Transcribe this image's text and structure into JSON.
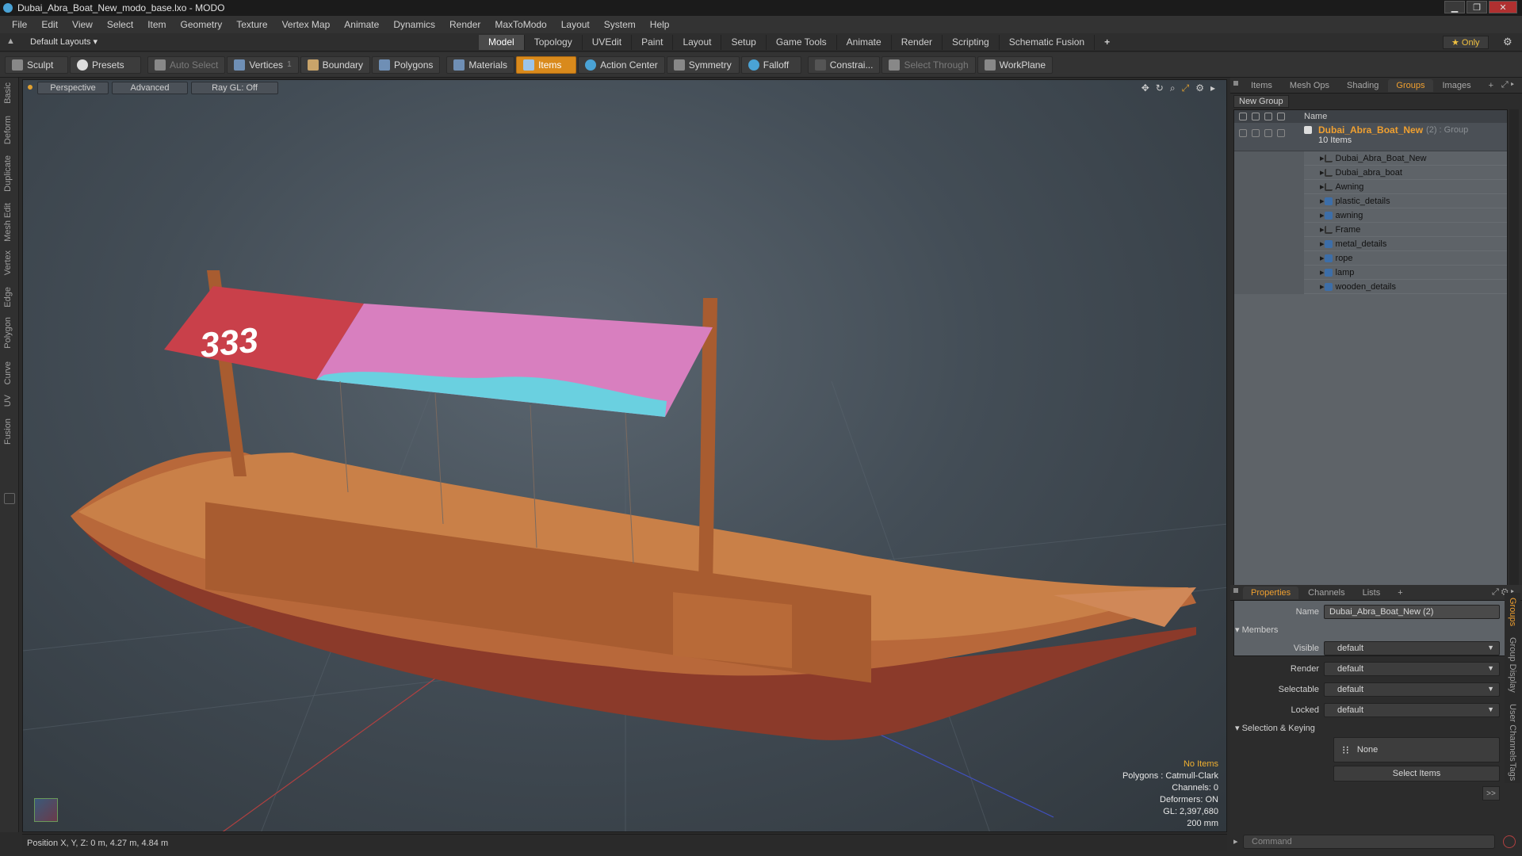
{
  "window": {
    "title": "Dubai_Abra_Boat_New_modo_base.lxo - MODO",
    "minimize": "▁",
    "maximize": "❐",
    "close": "✕"
  },
  "menu": [
    "File",
    "Edit",
    "View",
    "Select",
    "Item",
    "Geometry",
    "Texture",
    "Vertex Map",
    "Animate",
    "Dynamics",
    "Render",
    "MaxToModo",
    "Layout",
    "System",
    "Help"
  ],
  "layouts": {
    "default_label": "Default Layouts ▾",
    "tabs": [
      "Model",
      "Topology",
      "UVEdit",
      "Paint",
      "Layout",
      "Setup",
      "Game Tools",
      "Animate",
      "Render",
      "Scripting",
      "Schematic Fusion"
    ],
    "active_tab": "Model",
    "add": "+",
    "only": "★  Only"
  },
  "toolbar": {
    "sculpt": "Sculpt",
    "presets": "Presets",
    "auto_select": "Auto Select",
    "vertices": "Vertices",
    "vcount": "1",
    "boundary": "Boundary",
    "polygons": "Polygons",
    "materials": "Materials",
    "items": "Items",
    "action_center": "Action Center",
    "symmetry": "Symmetry",
    "falloff": "Falloff",
    "constrain": "Constrai...",
    "select_through": "Select Through",
    "workplane": "WorkPlane"
  },
  "left_tabs": [
    "Basic",
    "Deform",
    "Duplicate",
    "Mesh Edit",
    "Vertex",
    "Edge",
    "Polygon",
    "Curve",
    "UV",
    "Fusion"
  ],
  "viewport": {
    "perspective": "Perspective",
    "advanced": "Advanced",
    "raygl": "Ray GL: Off",
    "canopy_number": "333",
    "info": {
      "no_items": "No Items",
      "polygons": "Polygons : Catmull-Clark",
      "channels": "Channels: 0",
      "deformers": "Deformers: ON",
      "gl": "GL: 2,397,680",
      "scale": "200 mm"
    }
  },
  "status": {
    "position": "Position X, Y, Z:  0 m, 4.27 m, 4.84 m"
  },
  "top_panel": {
    "tabs": [
      "Items",
      "Mesh Ops",
      "Shading",
      "Groups",
      "Images",
      "+"
    ],
    "active": "Groups",
    "new_group": "New Group",
    "name_header": "Name",
    "root": {
      "name": "Dubai_Abra_Boat_New",
      "suffix": "(2) : Group",
      "count": "10 Items"
    },
    "items": [
      {
        "name": "Dubai_Abra_Boat_New",
        "icon": "locator-icon"
      },
      {
        "name": "Dubai_abra_boat",
        "icon": "locator-icon"
      },
      {
        "name": "Awning",
        "icon": "locator-icon"
      },
      {
        "name": "plastic_details",
        "icon": "mesh-icon"
      },
      {
        "name": "awning",
        "icon": "mesh-icon"
      },
      {
        "name": "Frame",
        "icon": "locator-icon"
      },
      {
        "name": "metal_details",
        "icon": "mesh-icon"
      },
      {
        "name": "rope",
        "icon": "mesh-icon"
      },
      {
        "name": "lamp",
        "icon": "mesh-icon"
      },
      {
        "name": "wooden_details",
        "icon": "mesh-icon"
      }
    ]
  },
  "properties": {
    "tabs": [
      "Properties",
      "Channels",
      "Lists",
      "+"
    ],
    "active": "Properties",
    "name_label": "Name",
    "name_value": "Dubai_Abra_Boat_New (2)",
    "members": "Members",
    "visible_label": "Visible",
    "render_label": "Render",
    "selectable_label": "Selectable",
    "locked_label": "Locked",
    "default_value": "default",
    "sel_keying": "Selection & Keying",
    "none": "None",
    "select_items": "Select Items",
    "more": ">>",
    "side_tabs": [
      "Groups",
      "Group Display",
      "User Channels",
      "Tags"
    ],
    "command_placeholder": "Command"
  },
  "colors": {
    "accent": "#f0a030",
    "wood": "#b8683a"
  }
}
